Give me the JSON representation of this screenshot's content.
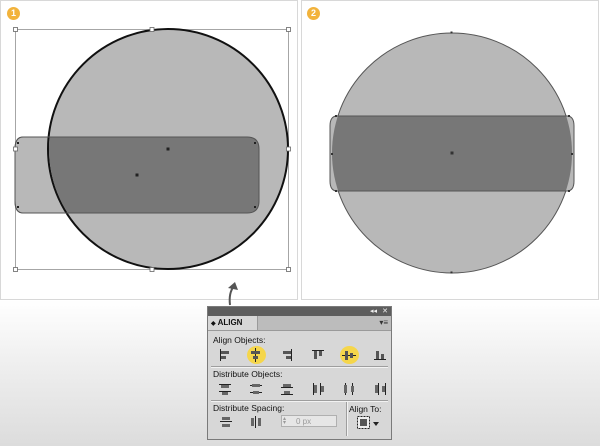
{
  "steps": {
    "step1": "1",
    "step2": "2"
  },
  "align_panel": {
    "tab_title": "ALIGN",
    "tab_collapse_glyph": "◆",
    "titlebar_collapse": "◂◂",
    "titlebar_close": "✕",
    "menu_glyph": "▾≡",
    "align_objects_label": "Align Objects:",
    "distribute_objects_label": "Distribute Objects:",
    "distribute_spacing_label": "Distribute Spacing:",
    "align_to_label": "Align To:",
    "spacing_value": "0 px",
    "align_objects_icons": [
      {
        "name": "horizontal-align-left-icon",
        "highlighted": false
      },
      {
        "name": "horizontal-align-center-icon",
        "highlighted": true
      },
      {
        "name": "horizontal-align-right-icon",
        "highlighted": false
      },
      {
        "name": "vertical-align-top-icon",
        "highlighted": false
      },
      {
        "name": "vertical-align-center-icon",
        "highlighted": true
      },
      {
        "name": "vertical-align-bottom-icon",
        "highlighted": false
      }
    ],
    "distribute_objects_icons": [
      {
        "name": "vertical-distribute-top-icon"
      },
      {
        "name": "vertical-distribute-center-icon"
      },
      {
        "name": "vertical-distribute-bottom-icon"
      },
      {
        "name": "horizontal-distribute-left-icon"
      },
      {
        "name": "horizontal-distribute-center-icon"
      },
      {
        "name": "horizontal-distribute-right-icon"
      }
    ]
  },
  "colors": {
    "badge": "#f2b33c",
    "highlight": "#f5d64b",
    "circle_fill": "#b8b8b8",
    "overlap_fill": "#777777",
    "panel_bg": "#d7d7d7"
  }
}
